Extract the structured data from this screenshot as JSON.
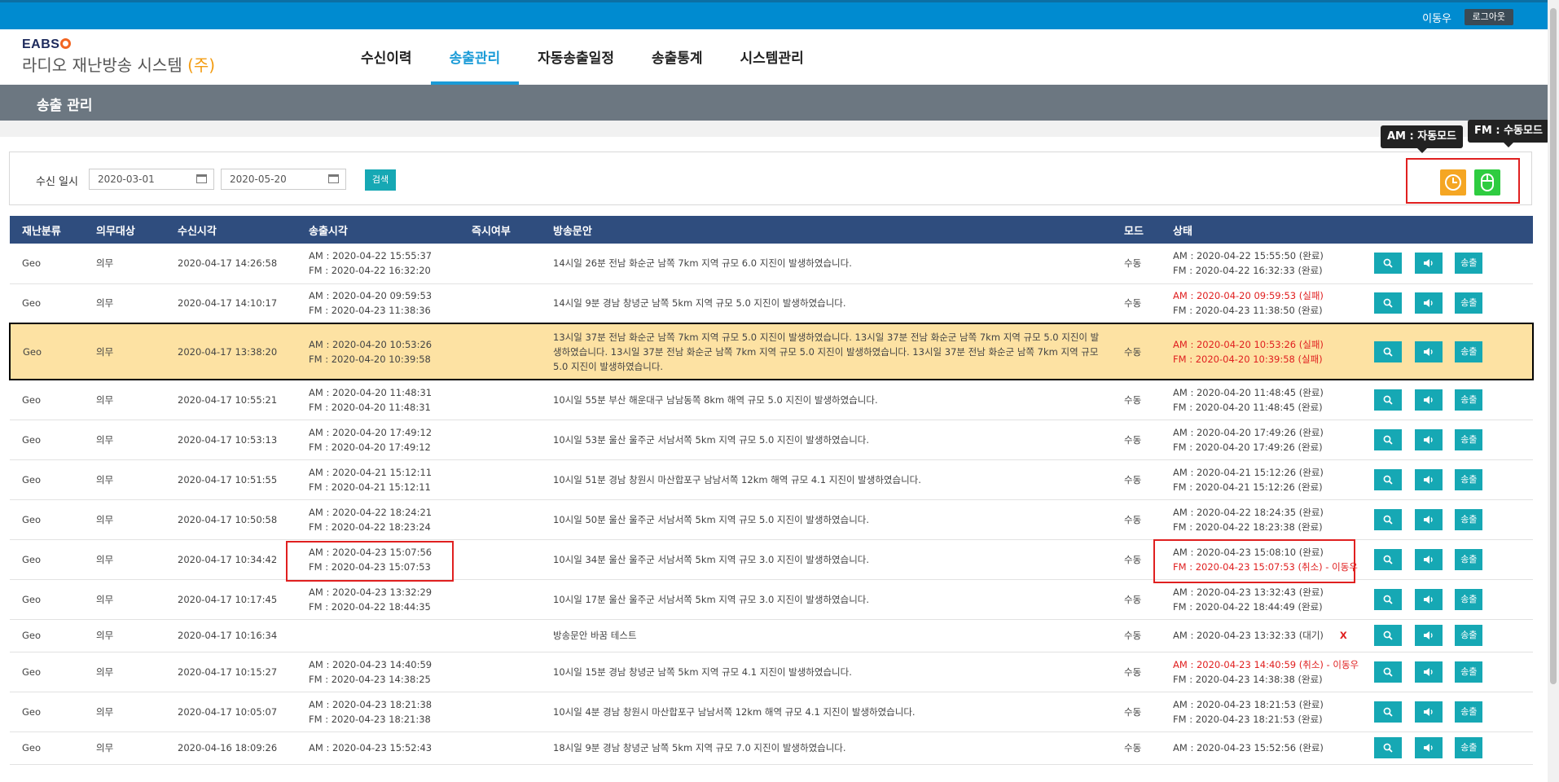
{
  "header": {
    "user_name": "이동우",
    "logout_label": "로그아웃",
    "logo_brand": "EABS",
    "logo_title": "라디오 재난방송 시스템",
    "logo_suffix": "(주)"
  },
  "nav": [
    {
      "label": "수신이력",
      "active": false
    },
    {
      "label": "송출관리",
      "active": true
    },
    {
      "label": "자동송출일정",
      "active": false
    },
    {
      "label": "송출통계",
      "active": false
    },
    {
      "label": "시스템관리",
      "active": false
    }
  ],
  "page_title": "송출 관리",
  "search": {
    "label": "수신 일시",
    "start_date": "2020-03-01",
    "end_date": "2020-05-20",
    "button_label": "검색"
  },
  "mode": {
    "am_tooltip": "AM : 자동모드",
    "fm_tooltip": "FM : 수동모드",
    "am_icon": "clock-icon",
    "fm_icon": "mouse-icon",
    "am_color": "#f5a623",
    "fm_color": "#2ecc40"
  },
  "table": {
    "headers": [
      "재난분류",
      "의무대상",
      "수신시각",
      "송출시각",
      "즉시여부",
      "방송문안",
      "모드",
      "상태",
      ""
    ],
    "action_labels": {
      "send": "송출"
    },
    "rows": [
      {
        "cat": "Geo",
        "duty": "의무",
        "recv": "2020-04-17 14:26:58",
        "send1": "AM : 2020-04-22 15:55:37",
        "send2": "FM : 2020-04-22 16:32:20",
        "text": "14시일 26분 전남 화순군 남쪽 7km 지역 규모 6.0 지진이 발생하였습니다.",
        "mode": "수동",
        "st1": "AM : 2020-04-22 15:55:50 (완료)",
        "st2": "FM : 2020-04-22 16:32:33 (완료)",
        "st1_red": false,
        "st2_red": false
      },
      {
        "cat": "Geo",
        "duty": "의무",
        "recv": "2020-04-17 14:10:17",
        "send1": "AM : 2020-04-20 09:59:53",
        "send2": "FM : 2020-04-23 11:38:36",
        "text": "14시일 9분 경남 창녕군 남쪽 5km 지역 규모 5.0 지진이 발생하였습니다.",
        "mode": "수동",
        "st1": "AM : 2020-04-20 09:59:53 (실패)",
        "st2": "FM : 2020-04-23 11:38:50 (완료)",
        "st1_red": true,
        "st2_red": false
      },
      {
        "cat": "Geo",
        "duty": "의무",
        "recv": "2020-04-17 13:38:20",
        "send1": "AM : 2020-04-20 10:53:26",
        "send2": "FM : 2020-04-20 10:39:58",
        "text": "13시일 37분 전남 화순군 남쪽 7km 지역 규모 5.0 지진이 발생하였습니다. 13시일 37분 전남 화순군 남쪽 7km 지역 규모 5.0 지진이 발생하였습니다. 13시일 37분 전남 화순군 남쪽 7km 지역 규모 5.0 지진이 발생하였습니다. 13시일 37분 전남 화순군 남쪽 7km 지역 규모 5.0 지진이 발생하였습니다.",
        "mode": "수동",
        "st1": "AM : 2020-04-20 10:53:26 (실패)",
        "st2": "FM : 2020-04-20 10:39:58 (실패)",
        "st1_red": true,
        "st2_red": true,
        "highlight": true
      },
      {
        "cat": "Geo",
        "duty": "의무",
        "recv": "2020-04-17 10:55:21",
        "send1": "AM : 2020-04-20 11:48:31",
        "send2": "FM : 2020-04-20 11:48:31",
        "text": "10시일 55분 부산 해운대구 남남동쪽 8km 해역 규모 5.0 지진이 발생하였습니다.",
        "mode": "수동",
        "st1": "AM : 2020-04-20 11:48:45 (완료)",
        "st2": "FM : 2020-04-20 11:48:45 (완료)",
        "st1_red": false,
        "st2_red": false
      },
      {
        "cat": "Geo",
        "duty": "의무",
        "recv": "2020-04-17 10:53:13",
        "send1": "AM : 2020-04-20 17:49:12",
        "send2": "FM : 2020-04-20 17:49:12",
        "text": "10시일 53분 울산 울주군 서남서쪽 5km 지역 규모 5.0 지진이 발생하였습니다.",
        "mode": "수동",
        "st1": "AM : 2020-04-20 17:49:26 (완료)",
        "st2": "FM : 2020-04-20 17:49:26 (완료)",
        "st1_red": false,
        "st2_red": false
      },
      {
        "cat": "Geo",
        "duty": "의무",
        "recv": "2020-04-17 10:51:55",
        "send1": "AM : 2020-04-21 15:12:11",
        "send2": "FM : 2020-04-21 15:12:11",
        "text": "10시일 51분 경남 창원시 마산합포구 남남서쪽 12km 해역 규모 4.1 지진이 발생하였습니다.",
        "mode": "수동",
        "st1": "AM : 2020-04-21 15:12:26 (완료)",
        "st2": "FM : 2020-04-21 15:12:26 (완료)",
        "st1_red": false,
        "st2_red": false
      },
      {
        "cat": "Geo",
        "duty": "의무",
        "recv": "2020-04-17 10:50:58",
        "send1": "AM : 2020-04-22 18:24:21",
        "send2": "FM : 2020-04-22 18:23:24",
        "text": "10시일 50분 울산 울주군 서남서쪽 5km 지역 규모 5.0 지진이 발생하였습니다.",
        "mode": "수동",
        "st1": "AM : 2020-04-22 18:24:35 (완료)",
        "st2": "FM : 2020-04-22 18:23:38 (완료)",
        "st1_red": false,
        "st2_red": false
      },
      {
        "cat": "Geo",
        "duty": "의무",
        "recv": "2020-04-17 10:34:42",
        "send1": "AM : 2020-04-23 15:07:56",
        "send2": "FM : 2020-04-23 15:07:53",
        "text": "10시일 34분 울산 울주군 서남서쪽 5km 지역 규모 3.0 지진이 발생하였습니다.",
        "mode": "수동",
        "st1": "AM : 2020-04-23 15:08:10 (완료)",
        "st2": "FM : 2020-04-23 15:07:53 (취소) - 이동우",
        "st1_red": false,
        "st2_red": true
      },
      {
        "cat": "Geo",
        "duty": "의무",
        "recv": "2020-04-17 10:17:45",
        "send1": "AM : 2020-04-23 13:32:29",
        "send2": "FM : 2020-04-22 18:44:35",
        "text": "10시일 17분 울산 울주군 서남서쪽 5km 지역 규모 3.0 지진이 발생하였습니다.",
        "mode": "수동",
        "st1": "AM : 2020-04-23 13:32:43 (완료)",
        "st2": "FM : 2020-04-22 18:44:49 (완료)",
        "st1_red": false,
        "st2_red": false
      },
      {
        "cat": "Geo",
        "duty": "의무",
        "recv": "2020-04-17 10:16:34",
        "send1": "",
        "send2": "",
        "text": "방송문안 바꿈 테스트",
        "mode": "수동",
        "st1": "AM : 2020-04-23 13:32:33 (대기)",
        "st2": "",
        "st1_red": false,
        "st2_red": false,
        "x": "X"
      },
      {
        "cat": "Geo",
        "duty": "의무",
        "recv": "2020-04-17 10:15:27",
        "send1": "AM : 2020-04-23 14:40:59",
        "send2": "FM : 2020-04-23 14:38:25",
        "text": "10시일 15분 경남 창녕군 남쪽 5km 지역 규모 4.1 지진이 발생하였습니다.",
        "mode": "수동",
        "st1": "AM : 2020-04-23 14:40:59 (취소) - 이동우",
        "st2": "FM : 2020-04-23 14:38:38 (완료)",
        "st1_red": true,
        "st2_red": false
      },
      {
        "cat": "Geo",
        "duty": "의무",
        "recv": "2020-04-17 10:05:07",
        "send1": "AM : 2020-04-23 18:21:38",
        "send2": "FM : 2020-04-23 18:21:38",
        "text": "10시일 4분 경남 창원시 마산합포구 남남서쪽 12km 해역 규모 4.1 지진이 발생하였습니다.",
        "mode": "수동",
        "st1": "AM : 2020-04-23 18:21:53 (완료)",
        "st2": "FM : 2020-04-23 18:21:53 (완료)",
        "st1_red": false,
        "st2_red": false
      },
      {
        "cat": "Geo",
        "duty": "의무",
        "recv": "2020-04-16 18:09:26",
        "send1": "AM : 2020-04-23 15:52:43",
        "send2": "",
        "text": "18시일 9분 경남 창녕군 남쪽 5km 지역 규모 7.0 지진이 발생하였습니다.",
        "mode": "수동",
        "st1": "AM : 2020-04-23 15:52:56 (완료)",
        "st2": "",
        "st1_red": false,
        "st2_red": false
      }
    ]
  }
}
